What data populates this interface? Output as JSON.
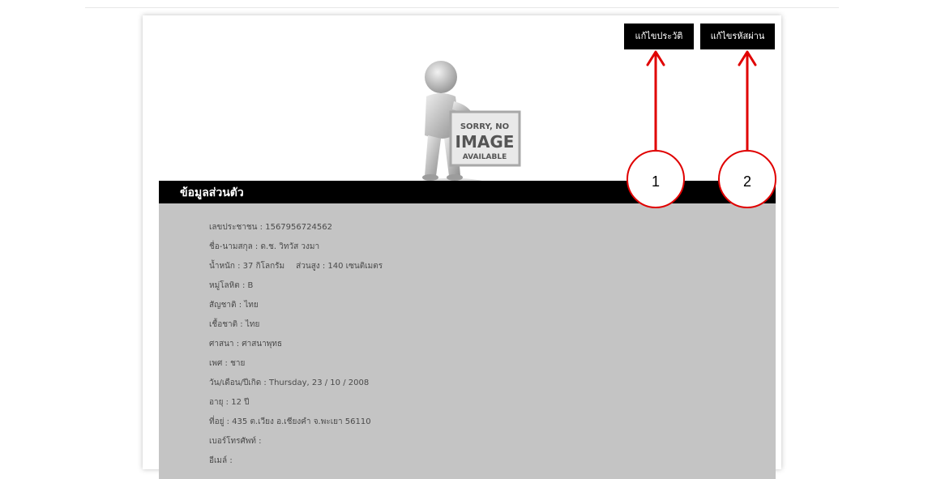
{
  "toolbar": {
    "edit_profile_label": "แก้ไขประวัติ",
    "change_password_label": "แก้ไขรหัสผ่าน"
  },
  "placeholder_image": {
    "line1": "SORRY, NO",
    "line2": "IMAGE",
    "line3": "AVAILABLE"
  },
  "section": {
    "title": "ข้อมูลส่วนตัว"
  },
  "profile": {
    "id_card": "เลขประชาชน : 1567956724562",
    "full_name": "ชื่อ-นามสกุล : ด.ช. วิทวัส วงมา",
    "weight": "น้ำหนัก : 37 กิโลกรัม",
    "height": "ส่วนสูง : 140 เซนติเมตร",
    "blood_group": "หมู่โลหิต : B",
    "nationality": "สัญชาติ : ไทย",
    "ethnicity": "เชื้อชาติ : ไทย",
    "religion": "ศาสนา : ศาสนาพุทธ",
    "gender": "เพศ : ชาย",
    "birth_date": "วัน/เดือน/ปีเกิด : Thursday, 23 / 10 / 2008",
    "age": "อายุ : 12 ปี",
    "address": "ที่อยู่ : 435 ต.เวียง อ.เชียงคำ จ.พะเยา 56110",
    "phone": "เบอร์โทรศัพท์ :",
    "email": "อีเมล์ :"
  },
  "annotations": {
    "callout_1": "1",
    "callout_2": "2",
    "color": "#e00000"
  }
}
